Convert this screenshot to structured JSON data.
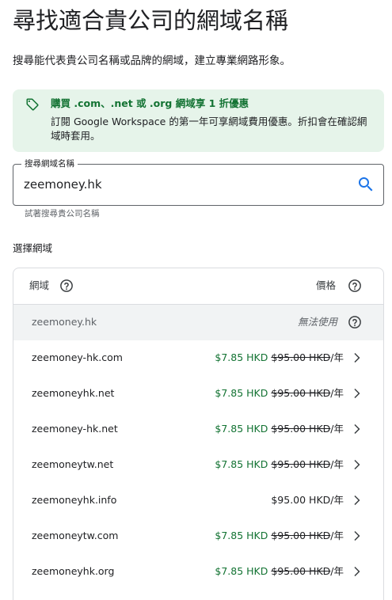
{
  "header": {
    "title": "尋找適合貴公司的網域名稱",
    "subtitle": "搜尋能代表貴公司名稱或品牌的網域，建立專業網路形象。"
  },
  "promo": {
    "icon": "tag-icon",
    "title": "購買 .com、.net 或 .org 網域享 1 折優惠",
    "description": "訂閱 Google Workspace 的第一年可享網域費用優惠。折扣會在確認網域時套用。",
    "color": "#137333",
    "background": "#e6f4ea"
  },
  "search": {
    "label": "搜尋網域名稱",
    "value": "zeemoney.hk",
    "helper": "試著搜尋貴公司名稱",
    "icon": "search-icon",
    "accent": "#1a73e8"
  },
  "section": {
    "label": "選擇網域"
  },
  "table": {
    "headers": {
      "domain": "網域",
      "price": "價格"
    },
    "rows": [
      {
        "domain": "zeemoney.hk",
        "status": "unavailable",
        "status_text": "無法使用"
      },
      {
        "domain": "zeemoney-hk.com",
        "sale_price": "$7.85 HKD",
        "orig_price": "$95.00 HKD",
        "period": "/年"
      },
      {
        "domain": "zeemoneyhk.net",
        "sale_price": "$7.85 HKD",
        "orig_price": "$95.00 HKD",
        "period": "/年"
      },
      {
        "domain": "zeemoney-hk.net",
        "sale_price": "$7.85 HKD",
        "orig_price": "$95.00 HKD",
        "period": "/年"
      },
      {
        "domain": "zeemoneytw.net",
        "sale_price": "$7.85 HKD",
        "orig_price": "$95.00 HKD",
        "period": "/年"
      },
      {
        "domain": "zeemoneyhk.info",
        "sale_price": "",
        "orig_price": "$95.00 HKD",
        "period": "/年",
        "no_discount": true
      },
      {
        "domain": "zeemoneytw.com",
        "sale_price": "$7.85 HKD",
        "orig_price": "$95.00 HKD",
        "period": "/年"
      },
      {
        "domain": "zeemoneyhk.org",
        "sale_price": "$7.85 HKD",
        "orig_price": "$95.00 HKD",
        "period": "/年"
      }
    ]
  }
}
